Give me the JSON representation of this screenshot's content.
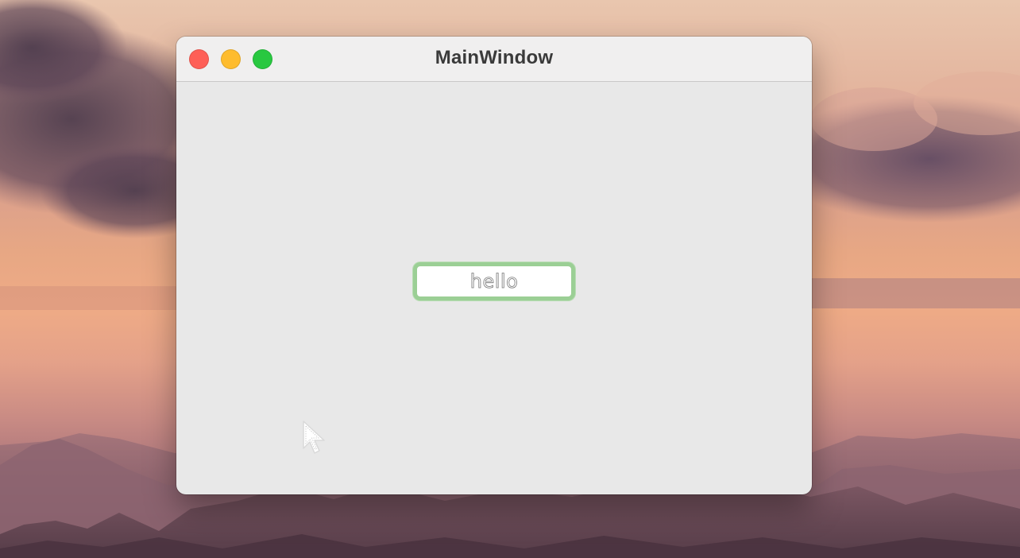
{
  "window": {
    "title": "MainWindow"
  },
  "text_field": {
    "value": "hello"
  },
  "colors": {
    "close": "#fe5f57",
    "minimize": "#febc2e",
    "maximize": "#28c840",
    "focus_ring": "#9bcf95"
  },
  "icons": {
    "pointer": "arrow-cursor-icon"
  }
}
